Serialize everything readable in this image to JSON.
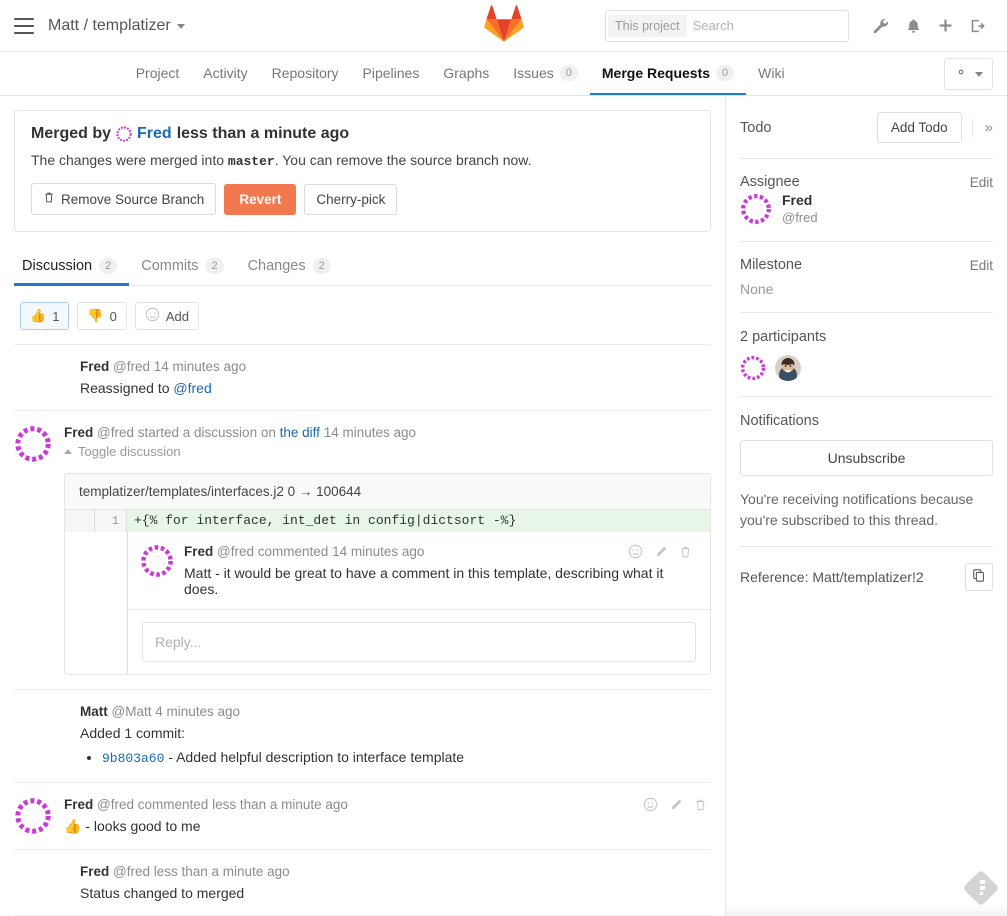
{
  "navbar": {
    "menu_icon": "hamburger-icon",
    "project_path": "Matt / templatizer",
    "logo_icon": "gitlab-logo-icon",
    "search": {
      "scope": "This project",
      "placeholder": "Search",
      "value": ""
    },
    "icons": [
      "wrench-icon",
      "bell-icon",
      "plus-icon",
      "sign-out-icon"
    ]
  },
  "subnav": {
    "items": [
      {
        "label": "Project",
        "count": null,
        "active": false
      },
      {
        "label": "Activity",
        "count": null,
        "active": false
      },
      {
        "label": "Repository",
        "count": null,
        "active": false
      },
      {
        "label": "Pipelines",
        "count": null,
        "active": false
      },
      {
        "label": "Graphs",
        "count": null,
        "active": false
      },
      {
        "label": "Issues",
        "count": "0",
        "active": false
      },
      {
        "label": "Merge Requests",
        "count": "0",
        "active": true
      },
      {
        "label": "Wiki",
        "count": null,
        "active": false
      }
    ],
    "settings_icon": "gear-icon"
  },
  "merged": {
    "title_prefix": "Merged by",
    "author": "Fred",
    "time": "less than a minute ago",
    "desc_before": "The changes were merged into",
    "branch": "master",
    "desc_after": ". You can remove the source branch now.",
    "buttons": {
      "remove_source_branch": "Remove Source Branch",
      "revert": "Revert",
      "cherry_pick": "Cherry-pick"
    },
    "revert_color": "#f4784f"
  },
  "tabs": [
    {
      "label": "Discussion",
      "count": "2",
      "active": true
    },
    {
      "label": "Commits",
      "count": "2",
      "active": false
    },
    {
      "label": "Changes",
      "count": "2",
      "active": false
    }
  ],
  "awards": [
    {
      "icon": "thumbs-up-emoji",
      "count": "1",
      "selected": true
    },
    {
      "icon": "thumbs-down-emoji",
      "count": "0",
      "selected": false
    },
    {
      "icon": "smiley-icon",
      "count": "Add",
      "selected": false
    }
  ],
  "notes": [
    {
      "type": "system",
      "author": "Fred",
      "handle": "@fred",
      "time": "14 minutes ago",
      "body_prefix": "Reassigned to",
      "body_link": "@fred"
    },
    {
      "type": "discussion",
      "author": "Fred",
      "handle": "@fred",
      "action": "started a discussion on",
      "target": "the diff",
      "time": "14 minutes ago",
      "toggle": "Toggle discussion",
      "diff": {
        "file": "templatizer/templates/interfaces.j2",
        "mode": "0 → 100644",
        "line_number": "1",
        "line_code": "+{% for interface, int_det in config|dictsort -%}",
        "comment": {
          "author": "Fred",
          "handle": "@fred",
          "action": "commented",
          "time": "14 minutes ago",
          "text": "Matt - it would be great to have a comment in this template, describing what it does.",
          "actions": [
            "smiley-icon",
            "pencil-icon",
            "trash-icon"
          ]
        },
        "reply_placeholder": "Reply..."
      }
    },
    {
      "type": "commit",
      "author": "Matt",
      "handle": "@Matt",
      "time": "4 minutes ago",
      "body": "Added 1 commit:",
      "commits": [
        {
          "sha": "9b803a60",
          "message": "- Added helpful description to interface template"
        }
      ]
    },
    {
      "type": "comment",
      "author": "Fred",
      "handle": "@fred",
      "action": "commented",
      "time": "less than a minute ago",
      "emoji": "thumbs-up-emoji",
      "text": "- looks good to me",
      "actions": [
        "smiley-icon",
        "pencil-icon",
        "trash-icon"
      ]
    },
    {
      "type": "system",
      "author": "Fred",
      "handle": "@fred",
      "time": "less than a minute ago",
      "body_prefix": "Status changed to merged",
      "body_link": ""
    }
  ],
  "sidebar": {
    "todo_label": "Todo",
    "add_todo_button": "Add Todo",
    "collapse_icon": "double-chevron-right-icon",
    "assignee_label": "Assignee",
    "assignee_edit": "Edit",
    "assignee_name": "Fred",
    "assignee_handle": "@fred",
    "milestone_label": "Milestone",
    "milestone_edit": "Edit",
    "milestone_value": "None",
    "participants_label": "2 participants",
    "notifications_label": "Notifications",
    "unsubscribe_button": "Unsubscribe",
    "notifications_text": "You're receiving notifications because you're subscribed to this thread.",
    "reference_label": "Reference: Matt/templatizer!2",
    "copy_icon": "copy-icon"
  },
  "footer": {
    "widget_icon": "feedly-icon"
  }
}
